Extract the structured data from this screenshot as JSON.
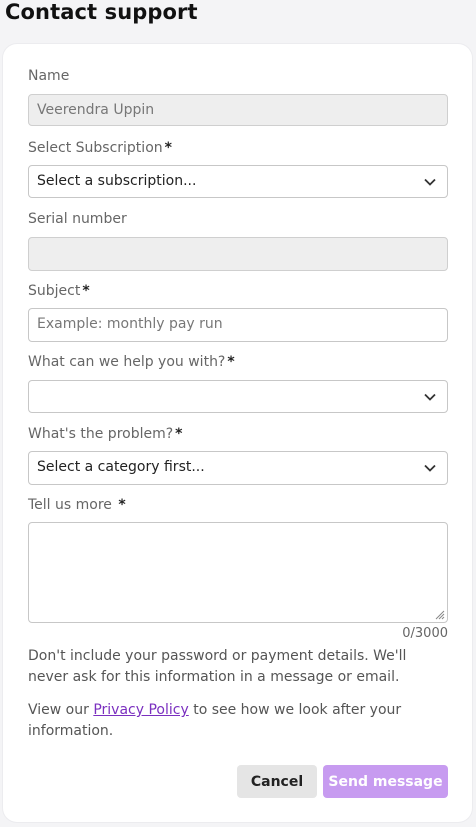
{
  "page": {
    "title": "Contact support"
  },
  "form": {
    "name": {
      "label": "Name",
      "value": "Veerendra Uppin"
    },
    "subscription": {
      "label": "Select Subscription",
      "required_mark": "*",
      "value": "Select a subscription..."
    },
    "serial": {
      "label": "Serial number",
      "value": ""
    },
    "subject": {
      "label": "Subject",
      "required_mark": "*",
      "placeholder": "Example: monthly pay run"
    },
    "help": {
      "label": "What can we help you with?",
      "required_mark": "*",
      "value": ""
    },
    "problem": {
      "label": "What's the problem?",
      "required_mark": "*",
      "value": "Select a category first..."
    },
    "details": {
      "label": "Tell us more",
      "required_mark": "*",
      "value": "",
      "counter": "0/3000"
    }
  },
  "notice": {
    "warning": "Don't include your password or payment details. We'll never ask for this information in a message or email.",
    "privacy_prefix": "View our ",
    "privacy_link": "Privacy Policy",
    "privacy_suffix": " to see how we look after your information."
  },
  "actions": {
    "cancel_label": "Cancel",
    "send_label": "Send message"
  },
  "colors": {
    "accent": "#7a2fbf",
    "send_button": "#c79bf0",
    "card": "#ffffff",
    "background": "#f4f4f6"
  },
  "icons": {
    "select_chevron": "chevron-down-icon",
    "resize": "resize-handle-icon"
  }
}
